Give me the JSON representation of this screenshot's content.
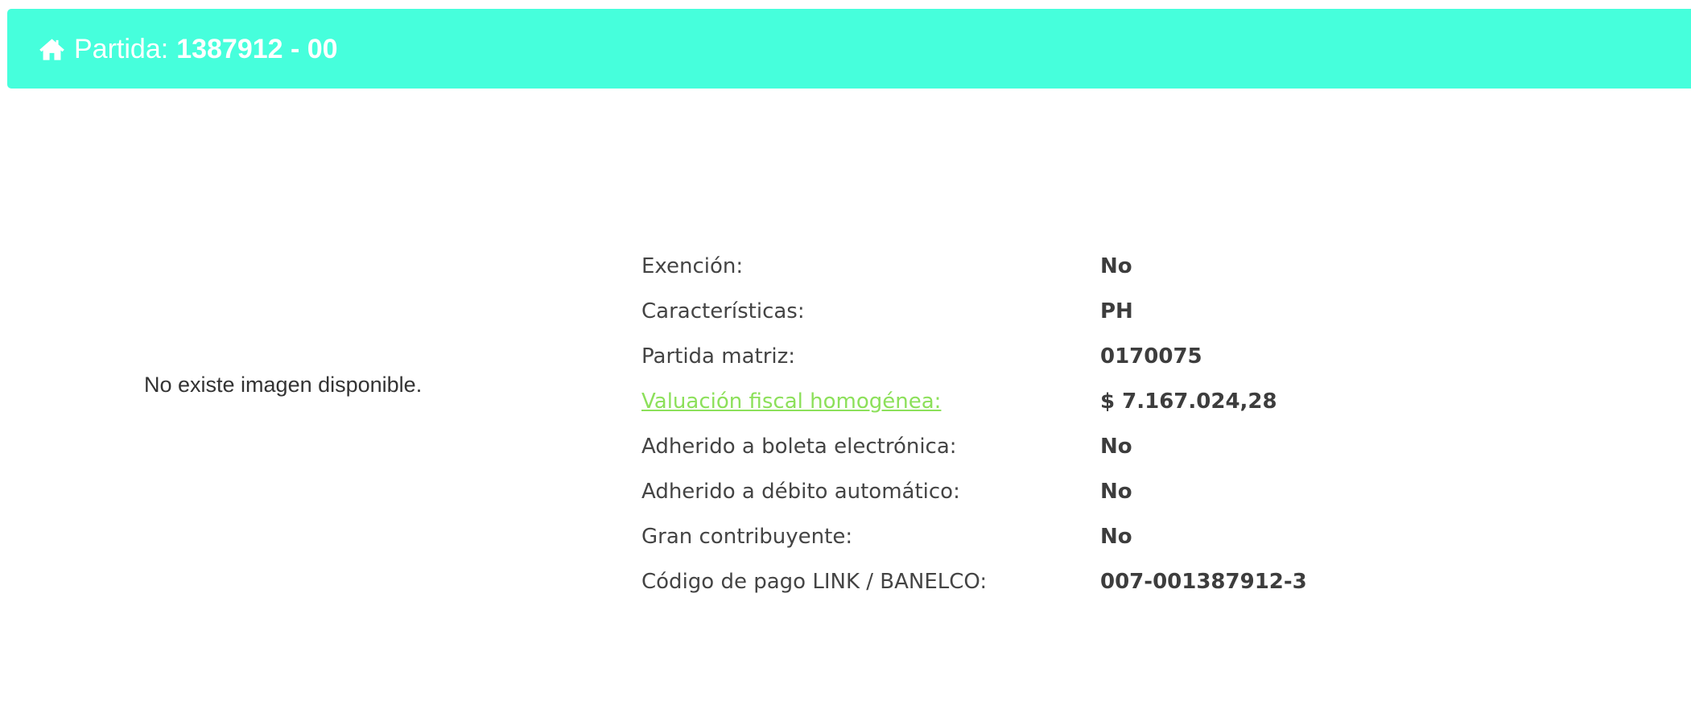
{
  "header": {
    "icon": "home-icon",
    "label": "Partida:",
    "number": "1387912 - 00",
    "background": "#46ffdc"
  },
  "image_panel": {
    "message": "No existe imagen disponible."
  },
  "details": [
    {
      "label": "Exención:",
      "value": "No"
    },
    {
      "label": "Características:",
      "value": "PH"
    },
    {
      "label": "Partida matriz:",
      "value": "0170075"
    },
    {
      "label": "Valuación fiscal homogénea:",
      "value": "$ 7.167.024,28",
      "link": true
    },
    {
      "label": "Adherido a boleta electrónica:",
      "value": "No"
    },
    {
      "label": "Adherido a débito automático:",
      "value": "No"
    },
    {
      "label": "Gran contribuyente:",
      "value": "No"
    },
    {
      "label": "Código de pago LINK / BANELCO:",
      "value": "007-001387912-3"
    }
  ],
  "colors": {
    "accent": "#46ffdc",
    "link": "#8ce05a",
    "text": "#444444"
  }
}
